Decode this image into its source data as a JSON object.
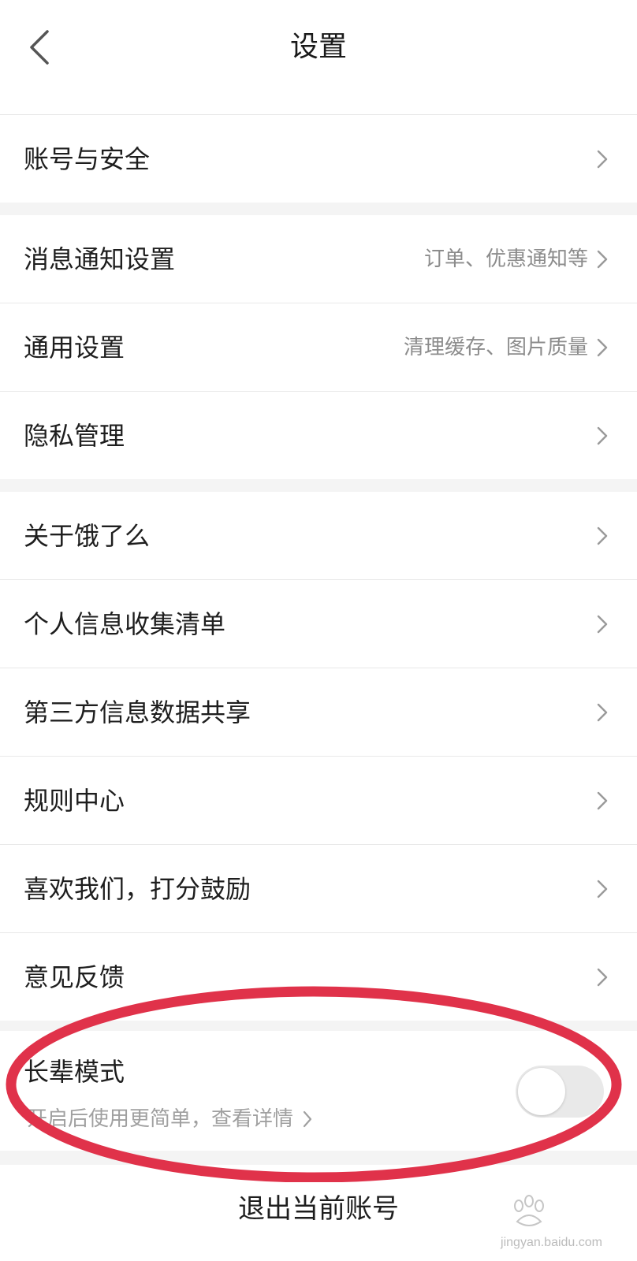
{
  "header": {
    "title": "设置"
  },
  "groups": [
    {
      "items": [
        {
          "label": "账号与安全",
          "hint": ""
        }
      ]
    },
    {
      "items": [
        {
          "label": "消息通知设置",
          "hint": "订单、优惠通知等"
        },
        {
          "label": "通用设置",
          "hint": "清理缓存、图片质量"
        },
        {
          "label": "隐私管理",
          "hint": ""
        }
      ]
    },
    {
      "items": [
        {
          "label": "关于饿了么",
          "hint": ""
        },
        {
          "label": "个人信息收集清单",
          "hint": ""
        },
        {
          "label": "第三方信息数据共享",
          "hint": ""
        },
        {
          "label": "规则中心",
          "hint": ""
        },
        {
          "label": "喜欢我们，打分鼓励",
          "hint": ""
        },
        {
          "label": "意见反馈",
          "hint": ""
        }
      ]
    }
  ],
  "elder_mode": {
    "title": "长辈模式",
    "subtitle": "开启后使用更简单，查看详情",
    "enabled": false
  },
  "logout_label": "退出当前账号",
  "watermark": {
    "url": "jingyan.baidu.com"
  },
  "colors": {
    "annotation_red": "#e0324a",
    "toggle_off": "#e9e9e9",
    "background": "#f4f4f4"
  }
}
